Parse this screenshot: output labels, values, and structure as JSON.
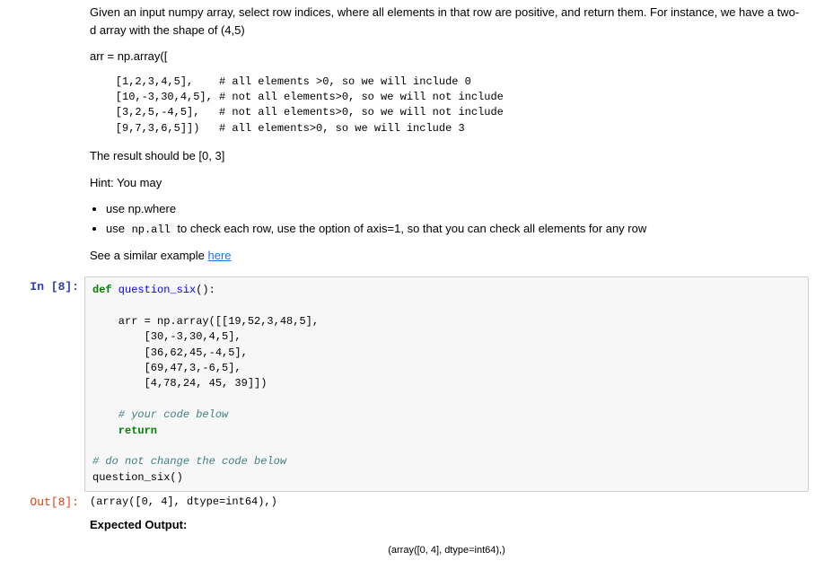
{
  "markdown": {
    "intro": "Given an input numpy array, select row indices, where all elements in that row are positive, and return them. For instance, we have a two-d array with the shape of (4,5)",
    "arr_decl": "arr = np.array([",
    "example_line1": "    [1,2,3,4,5],    # all elements >0, so we will include 0",
    "example_line2": "    [10,-3,30,4,5], # not all elements>0, so we will not include",
    "example_line3": "    [3,2,5,-4,5],   # not all elements>0, so we will not include",
    "example_line4": "    [9,7,3,6,5]])   # all elements>0, so we will include 3",
    "result_text": "The result should be [0, 3]",
    "hint_intro": "Hint: You may",
    "hint1": "use np.where",
    "hint2_pre": "use ",
    "hint2_code": "np.all",
    "hint2_post": " to check each row, use the option of axis=1, so that you can check all elements for any row",
    "see_similar_pre": "See a similar example ",
    "see_similar_link": "here"
  },
  "input_cell": {
    "prompt": "In [8]:",
    "line1_def": "def",
    "line1_name": " question_six",
    "line1_rest": "():",
    "line_blank": "",
    "line2": "    arr = np.array([[19,52,3,48,5],",
    "line3": "        [30,-3,30,4,5],",
    "line4": "        [36,62,45,-4,5],",
    "line5": "        [69,47,3,-6,5],",
    "line6": "        [4,78,24, 45, 39]])",
    "line7_comment": "    # your code below",
    "line8_return": "    return",
    "line9_comment": "# do not change the code below",
    "line10": "question_six()"
  },
  "output_cell": {
    "prompt": "Out[8]:",
    "text": "(array([0, 4], dtype=int64),)"
  },
  "expected": {
    "heading": "Expected Output:",
    "value": "(array([0, 4], dtype=int64),)"
  }
}
